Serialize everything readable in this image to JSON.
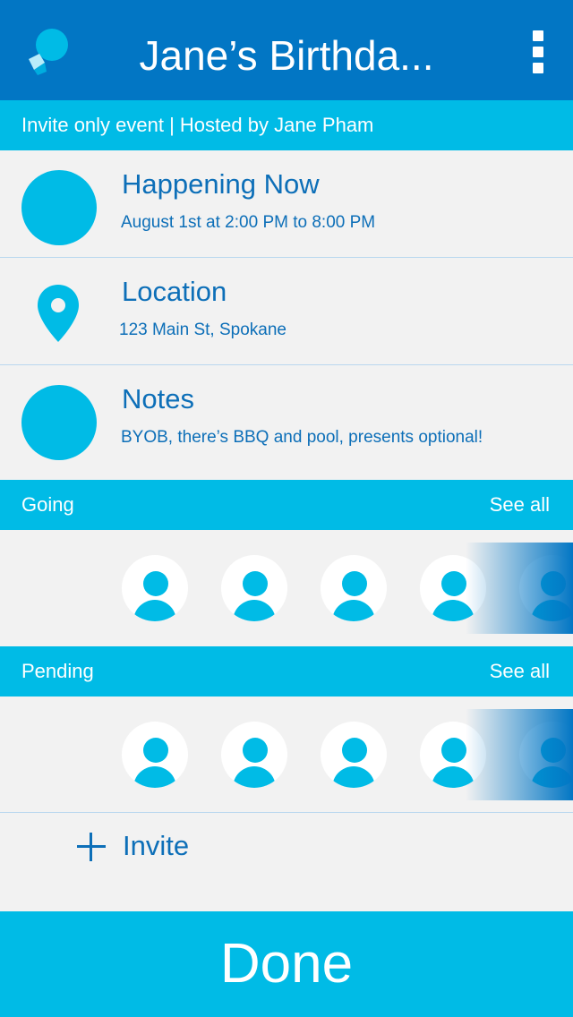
{
  "header": {
    "title": "Jane’s Birthda...",
    "logo_icon": "chat-bubble-logo",
    "menu_icon": "more-vertical-icon"
  },
  "event_meta": "Invite only event | Hosted by Jane Pham",
  "info": [
    {
      "title": "Happening Now",
      "detail": "August 1st at 2:00 PM to 8:00 PM",
      "icon": "circle-icon"
    },
    {
      "title": "Location",
      "detail": "123 Main St, Spokane",
      "icon": "map-pin-icon"
    },
    {
      "title": "Notes",
      "detail": "BYOB, there’s BBQ and pool, presents optional!",
      "icon": "circle-icon"
    }
  ],
  "going": {
    "label": "Going",
    "see_all": "See all",
    "avatar_icon": "person-icon"
  },
  "pending": {
    "label": "Pending",
    "see_all": "See all",
    "avatar_icon": "person-icon"
  },
  "invite": {
    "label": "Invite",
    "icon": "plus-icon"
  },
  "done_label": "Done",
  "colors": {
    "primary_dark": "#0276c4",
    "primary": "#00bbe6",
    "text_blue": "#0d6fb8",
    "background": "#f2f2f2"
  }
}
